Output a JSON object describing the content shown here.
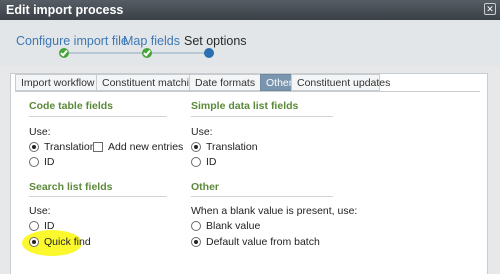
{
  "window": {
    "title": "Edit import process",
    "close_icon": "close-icon"
  },
  "steps": [
    {
      "label": "Configure import file",
      "state": "done"
    },
    {
      "label": "Map fields",
      "state": "done"
    },
    {
      "label": "Set options",
      "state": "current"
    }
  ],
  "tabs": [
    {
      "label": "Import workflow",
      "active": false
    },
    {
      "label": "Constituent matching",
      "active": false
    },
    {
      "label": "Date formats",
      "active": false
    },
    {
      "label": "Other",
      "active": true
    },
    {
      "label": "Constituent updates",
      "active": false
    }
  ],
  "code_table": {
    "title": "Code table fields",
    "use_label": "Use:",
    "translation": "Translation",
    "add_new": "Add new entries",
    "id": "ID",
    "selected": "Translation"
  },
  "simple_list": {
    "title": "Simple data list fields",
    "use_label": "Use:",
    "translation": "Translation",
    "id": "ID",
    "selected": "Translation"
  },
  "search_list": {
    "title": "Search list fields",
    "use_label": "Use:",
    "id": "ID",
    "quick_find": "Quick find",
    "selected": "Quick find"
  },
  "other": {
    "title": "Other",
    "blank_label": "When a blank value is present, use:",
    "blank_value": "Blank value",
    "default_value": "Default value from batch",
    "selected": "Default value from batch"
  },
  "colors": {
    "title_bar": "#3a4046",
    "section_title": "#5b8a3a",
    "step_link": "#3d78b4",
    "step_done": "#45a43a",
    "step_current": "#2a6fb0",
    "active_tab": "#7a95ae",
    "highlight": "#fbf82e"
  }
}
